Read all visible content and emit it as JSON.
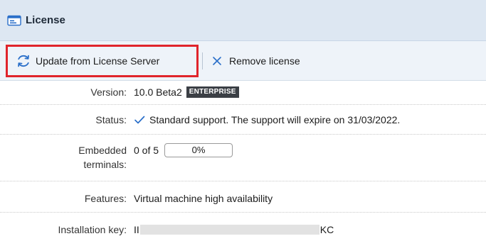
{
  "panel": {
    "title": "License"
  },
  "toolbar": {
    "update_label": "Update from License Server",
    "remove_label": "Remove license"
  },
  "fields": {
    "version": {
      "label": "Version:",
      "value": "10.0 Beta2",
      "badge": "ENTERPRISE"
    },
    "status": {
      "label": "Status:",
      "value": "Standard support. The support will expire on 31/03/2022."
    },
    "embedded": {
      "label": "Embedded terminals:",
      "value": "0 of 5",
      "progress_text": "0%",
      "progress_percent": 0
    },
    "features": {
      "label": "Features:",
      "value": "Virtual machine high availability"
    },
    "installation_key": {
      "label": "Installation key:",
      "value_start": "II",
      "value_end": "KC"
    }
  },
  "colors": {
    "highlight": "#e0242b",
    "titlebar": "#dde7f2",
    "toolbar": "#eef3f9",
    "accent": "#2a6fc9"
  },
  "icons": {
    "title": "license-card-icon",
    "update": "refresh-icon",
    "remove": "close-icon",
    "status": "check-icon"
  }
}
